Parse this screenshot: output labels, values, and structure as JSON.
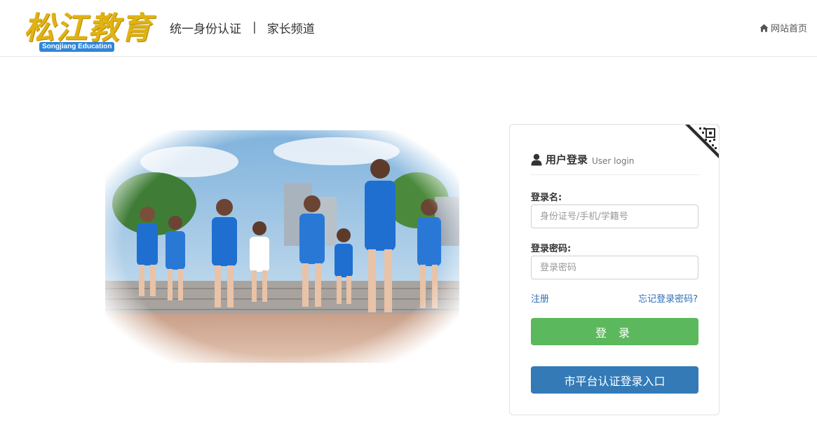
{
  "header": {
    "logo_cn": "松江教育",
    "logo_en": "Songjiang Education",
    "nav": {
      "item1": "统一身份认证",
      "separator": "|",
      "item2": "家长频道"
    },
    "home_link": "网站首页",
    "home_icon": "home-icon"
  },
  "login": {
    "title": "用户登录",
    "subtitle": "User login",
    "user_icon": "user-icon",
    "qr_icon": "qr-code-icon",
    "username_label": "登录名:",
    "username_placeholder": "身份证号/手机/学籍号",
    "username_value": "",
    "password_label": "登录密码:",
    "password_placeholder": "登录密码",
    "password_value": "",
    "register_link": "注册",
    "forgot_link": "忘记登录密码?",
    "login_button": "登 录",
    "city_button": "市平台认证登录入口"
  },
  "colors": {
    "logo_gold": "#e0b213",
    "logo_blue": "#2f86d8",
    "link_blue": "#2f6fb5",
    "login_green": "#5cb85c",
    "city_blue": "#337ab7"
  }
}
